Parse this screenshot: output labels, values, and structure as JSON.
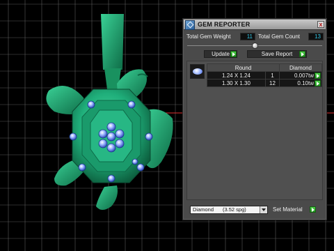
{
  "panel": {
    "title": "GEM REPORTER",
    "close_label": "x",
    "total_weight_label": "Total Gem Weight",
    "total_weight_value": "11",
    "total_count_label": "Total Gem Count",
    "total_count_value": "13",
    "slider_level": 0.5,
    "update_label": "Update",
    "save_report_label": "Save Report"
  },
  "gem_table": {
    "columns": [
      "Round",
      "Diamond"
    ],
    "rows": [
      {
        "size": "1.24 X 1.24",
        "count": "1",
        "weight": "0.007tw"
      },
      {
        "size": "1.30 X 1.30",
        "count": "12",
        "weight": "0.10tw"
      }
    ]
  },
  "material": {
    "selected": "Diamond",
    "spg": "(3.52 spg)",
    "set_label": "Set Material"
  },
  "colors": {
    "model_green": "#1fae7a",
    "gem_blue": "#5f86f2",
    "grid": "#6e6e6e",
    "axis_red": "#e03030",
    "accent_cyan": "#35c7e6"
  },
  "icons": [
    "gem-reporter-icon",
    "close-icon",
    "go-arrow-icon",
    "dropdown-arrow-icon",
    "gem-thumbnail-icon"
  ]
}
